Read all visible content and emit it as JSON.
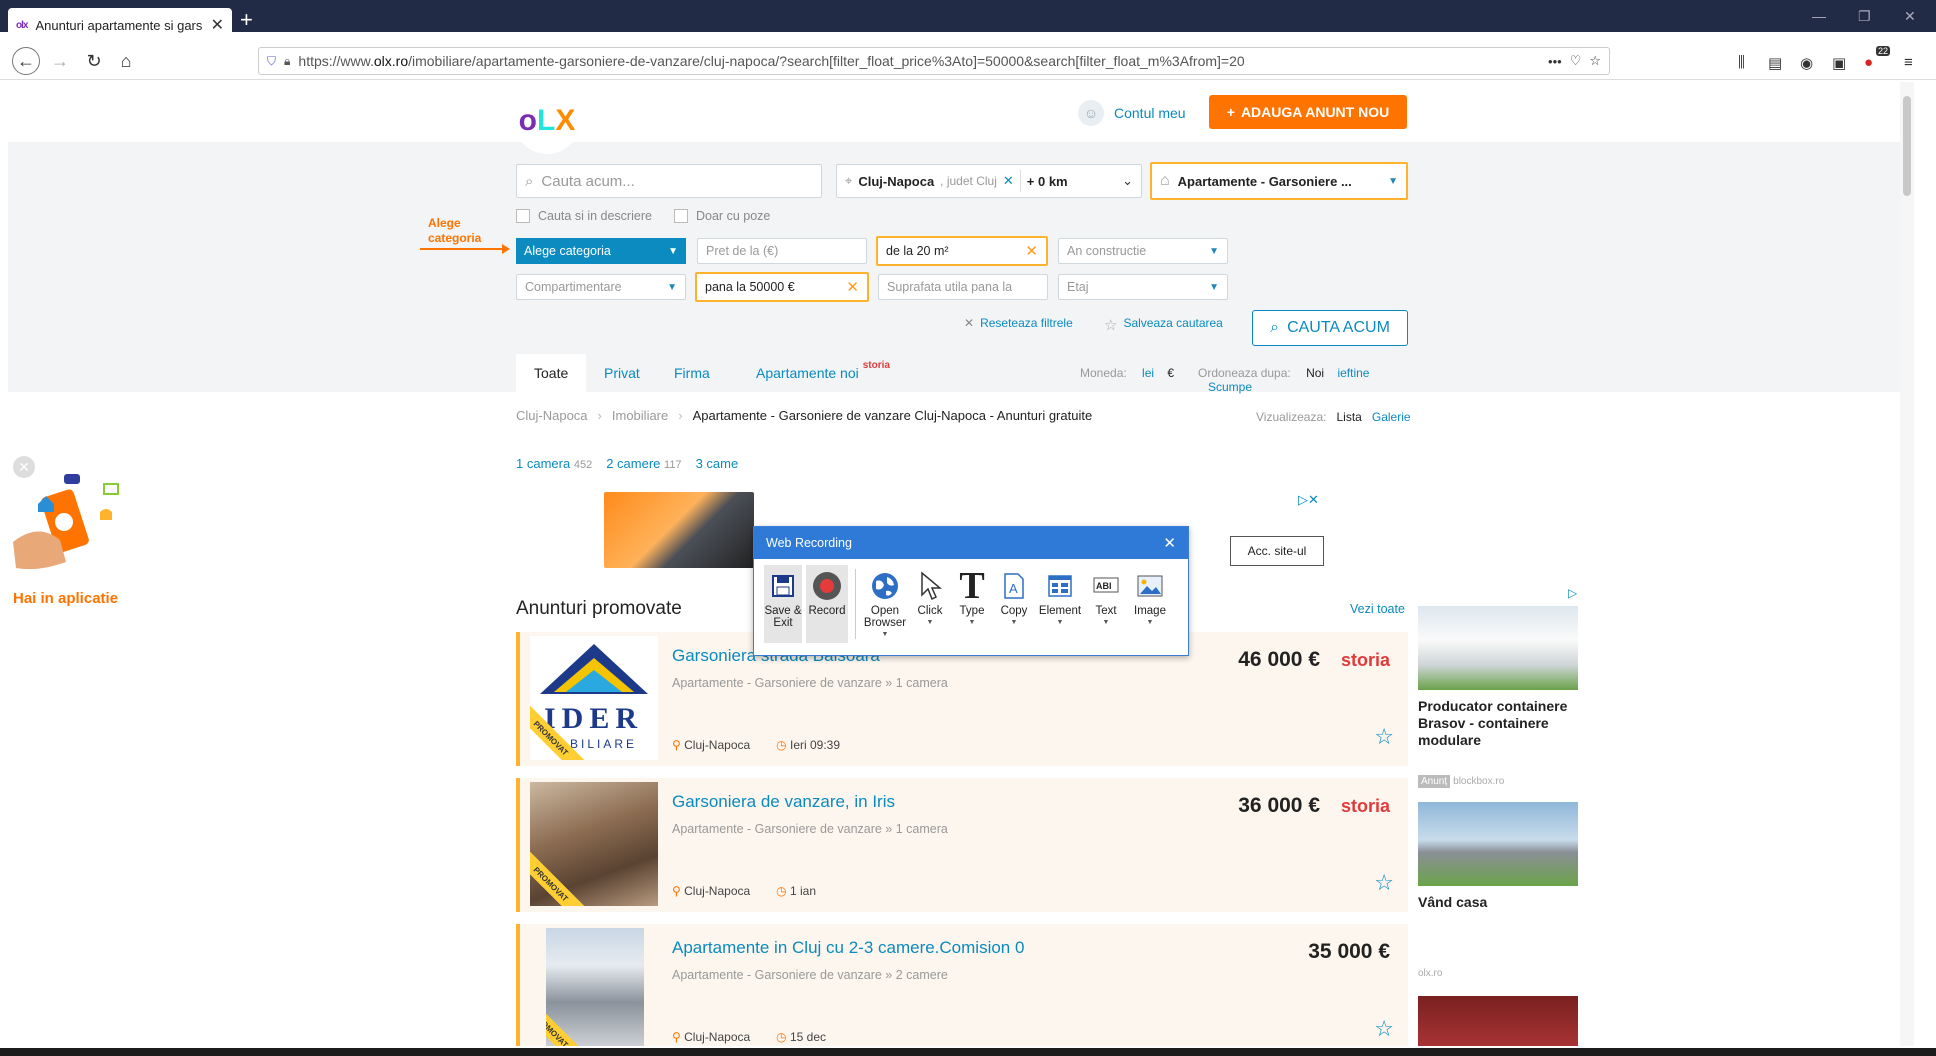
{
  "browser": {
    "tab_title": "Anunturi apartamente si garsoniere",
    "tab_favicon": "olx",
    "url_prefix": "https://www.",
    "url_domain": "olx.ro",
    "url_path": "/imobiliare/apartamente-garsoniere-de-vanzare/cluj-napoca/?search[filter_float_price%3Ato]=50000&search[filter_float_m%3Afrom]=20",
    "ext_badge": "22",
    "dots": "•••"
  },
  "header": {
    "account_label": "Contul meu",
    "add_button": "ADAUGA ANUNT NOU"
  },
  "search": {
    "placeholder": "Cauta acum...",
    "location_city": "Cluj-Napoca",
    "location_region": ", judet Cluj",
    "radius": "+ 0 km",
    "category": "Apartamente - Garsoniere ...",
    "check_description": "Cauta si in descriere",
    "check_photos": "Doar cu poze",
    "note_line1": "Alege",
    "note_line2": "categoria"
  },
  "filters": {
    "category_button": "Alege categoria",
    "price_from_ph": "Pret de la (€)",
    "area_from": "de la 20 m²",
    "year_ph": "An constructie",
    "compartment_ph": "Compartimentare",
    "price_to": "pana la 50000 €",
    "area_to_ph": "Suprafata utila pana la",
    "floor_ph": "Etaj",
    "reset": "Reseteaza filtrele",
    "save_search": "Salveaza cautarea",
    "search_button": "CAUTA ACUM"
  },
  "tabs": [
    "Toate",
    "Privat",
    "Firma",
    "Apartamente noi"
  ],
  "storia_sup": "storia",
  "sorting": {
    "currency_label": "Moneda:",
    "currency_lei": "lei",
    "currency_eur": "€",
    "order_label": "Ordoneaza dupa:",
    "order_new": "Noi",
    "order_cheap": "ieftine",
    "order_exp": "Scumpe"
  },
  "breadcrumb": {
    "c1": "Cluj-Napoca",
    "c2": "Imobiliare",
    "c3": "Apartamente - Garsoniere de vanzare Cluj-Napoca - Anunturi gratuite",
    "view_label": "Vizualizeaza:",
    "view_list": "Lista",
    "view_gallery": "Galerie"
  },
  "rooms": [
    {
      "label": "1 camera",
      "count": "452"
    },
    {
      "label": "2 camere",
      "count": "117"
    },
    {
      "label": "3 came",
      "count": ""
    }
  ],
  "ad_banner": {
    "button": "Acc. site-ul"
  },
  "app_promo": "Hai in aplicatie",
  "promoted": {
    "title": "Anunturi promovate",
    "see_all": "Vezi toate",
    "ribbon": "PROMOVAT",
    "items": [
      {
        "title": "Garsoniera strada Baisoara",
        "sub": "Apartamente - Garsoniere de vanzare » 1 camera",
        "price": "46 000 €",
        "storia": "storia",
        "loc": "Cluj-Napoca",
        "time": "Ieri 09:39"
      },
      {
        "title": "Garsoniera de vanzare, in Iris",
        "sub": "Apartamente - Garsoniere de vanzare » 1 camera",
        "price": "36 000 €",
        "storia": "storia",
        "loc": "Cluj-Napoca",
        "time": "1 ian"
      },
      {
        "title": "Apartamente in Cluj cu 2-3 camere.Comision 0",
        "sub": "Apartamente - Garsoniere de vanzare » 2 camere",
        "price": "35 000 €",
        "storia": "",
        "loc": "Cluj-Napoca",
        "time": "15 dec"
      }
    ]
  },
  "right_ads": {
    "ad1_title": "Producator containere Brasov - containere modulare",
    "ad1_tag": "Anunț",
    "ad1_src": "blockbox.ro",
    "ad2_title": "Vând casa",
    "ad2_src": "olx.ro"
  },
  "web_recording": {
    "title": "Web Recording",
    "buttons": [
      {
        "label": "Save & Exit",
        "icon": "floppy-icon"
      },
      {
        "label": "Record",
        "icon": "record-icon"
      },
      {
        "label": "Open Browser",
        "icon": "globe-icon"
      },
      {
        "label": "Click",
        "icon": "cursor-icon"
      },
      {
        "label": "Type",
        "icon": "type-icon"
      },
      {
        "label": "Copy",
        "icon": "copy-icon"
      },
      {
        "label": "Element",
        "icon": "element-icon"
      },
      {
        "label": "Text",
        "icon": "text-icon"
      },
      {
        "label": "Image",
        "icon": "image-icon"
      }
    ]
  },
  "colors": {
    "olx_purple": "#7a2cb3",
    "olx_teal": "#23e5db",
    "olx_orange": "#ff7400",
    "link_blue": "#0a8abf",
    "wr_blue": "#2e7ad6"
  }
}
